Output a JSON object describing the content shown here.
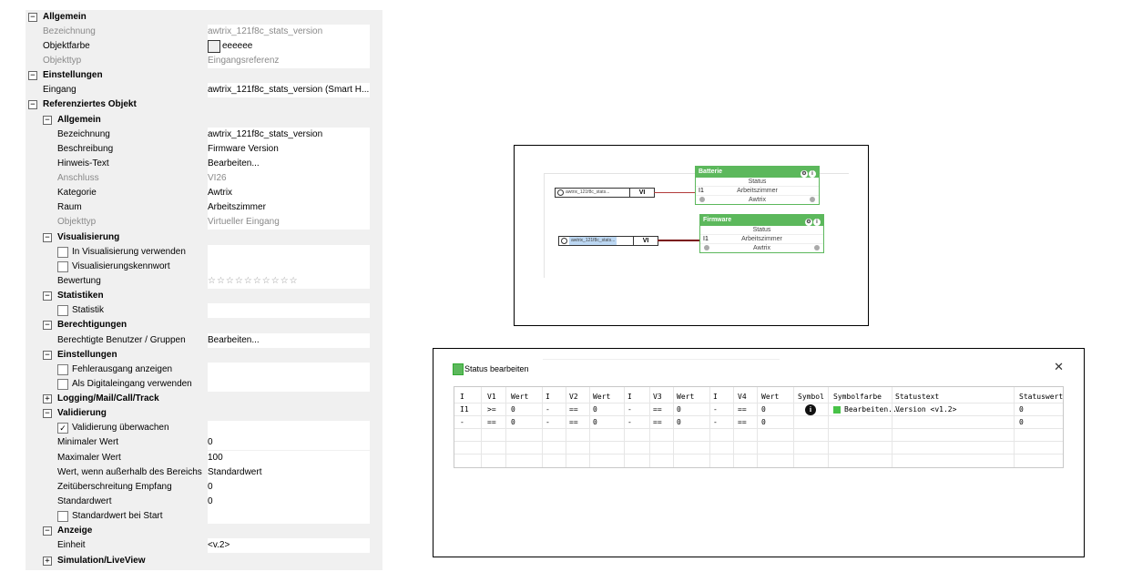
{
  "props": {
    "allgemein_top": "Allgemein",
    "bezeichnung_lbl": "Bezeichnung",
    "bezeichnung_val": "awtrix_121f8c_stats_version",
    "objektfarbe_lbl": "Objektfarbe",
    "objektfarbe_val": "eeeeee",
    "objektfarbe_color": "#eeeeee",
    "objekttyp_lbl": "Objekttyp",
    "objekttyp_val": "Eingangsreferenz",
    "einstellungen_top": "Einstellungen",
    "eingang_lbl": "Eingang",
    "eingang_val": "awtrix_121f8c_stats_version (Smart H...",
    "referenziertes": "Referenziertes Objekt",
    "allgemein_sub": "Allgemein",
    "r_bezeichnung_lbl": "Bezeichnung",
    "r_bezeichnung_val": "awtrix_121f8c_stats_version",
    "beschreibung_lbl": "Beschreibung",
    "beschreibung_val": "Firmware Version",
    "hinweis_lbl": "Hinweis-Text",
    "hinweis_val": "Bearbeiten...",
    "anschluss_lbl": "Anschluss",
    "anschluss_val": "VI26",
    "kategorie_lbl": "Kategorie",
    "kategorie_val": "Awtrix",
    "raum_lbl": "Raum",
    "raum_val": "Arbeitszimmer",
    "r_objekttyp_lbl": "Objekttyp",
    "r_objekttyp_val": "Virtueller Eingang",
    "visualisierung": "Visualisierung",
    "in_vis_lbl": "In Visualisierung verwenden",
    "vis_kennwort_lbl": "Visualisierungskennwort",
    "bewertung_lbl": "Bewertung",
    "bewertung_stars": "☆☆☆☆☆☆☆☆☆☆",
    "statistiken": "Statistiken",
    "statistik_lbl": "Statistik",
    "berechtigungen": "Berechtigungen",
    "berechtigte_lbl": "Berechtigte Benutzer / Gruppen",
    "berechtigte_val": "Bearbeiten...",
    "einstellungen_sub": "Einstellungen",
    "fehlerausgang_lbl": "Fehlerausgang anzeigen",
    "digitaleingang_lbl": "Als Digitaleingang verwenden",
    "logging": "Logging/Mail/Call/Track",
    "validierung": "Validierung",
    "valid_ueberwachen_lbl": "Validierung überwachen",
    "min_lbl": "Minimaler Wert",
    "min_val": "0",
    "max_lbl": "Maximaler Wert",
    "max_val": "100",
    "ausserhalb_lbl": "Wert, wenn außerhalb des Bereichs",
    "ausserhalb_val": "Standardwert",
    "zeitueber_lbl": "Zeitüberschreitung Empfang",
    "zeitueber_val": "0",
    "standardwert_lbl": "Standardwert",
    "standardwert_val": "0",
    "standard_start_lbl": "Standardwert bei Start",
    "anzeige": "Anzeige",
    "einheit_lbl": "Einheit",
    "einheit_val": "<v.2>",
    "simulation": "Simulation/LiveView"
  },
  "canvas": {
    "batterie": {
      "title": "Batterie",
      "status": "Status",
      "pin": "I1",
      "room": "Arbeitszimmer",
      "cat": "Awtrix"
    },
    "firmware": {
      "title": "Firmware",
      "status": "Status",
      "pin": "I1",
      "room": "Arbeitszimmer",
      "cat": "Awtrix"
    },
    "ref1_text": "awtrix_121f8c_stats...",
    "ref1_vi": "VI",
    "ref2_text": "awtrix_121f8c_stats...",
    "ref2_vi": "VI",
    "accent": "#5cb85c"
  },
  "dialog": {
    "title": "Status bearbeiten",
    "close": "✕",
    "headers": [
      "I",
      "V1",
      "Wert",
      "I",
      "V2",
      "Wert",
      "I",
      "V3",
      "Wert",
      "I",
      "V4",
      "Wert",
      "Symbol",
      "Symbolfarbe",
      "Statustext",
      "Statuswert"
    ],
    "row1": [
      "I1",
      ">=",
      "0",
      "-",
      "==",
      "0",
      "-",
      "==",
      "0",
      "-",
      "==",
      "0",
      "",
      "Bearbeiten...",
      "Version <v1.2>",
      "0"
    ],
    "row2": [
      "-",
      "==",
      "0",
      "-",
      "==",
      "0",
      "-",
      "==",
      "0",
      "-",
      "==",
      "0",
      "",
      "",
      "",
      "0"
    ],
    "symbol_glyph": "i",
    "symbolfarbe_color": "#47c247"
  }
}
